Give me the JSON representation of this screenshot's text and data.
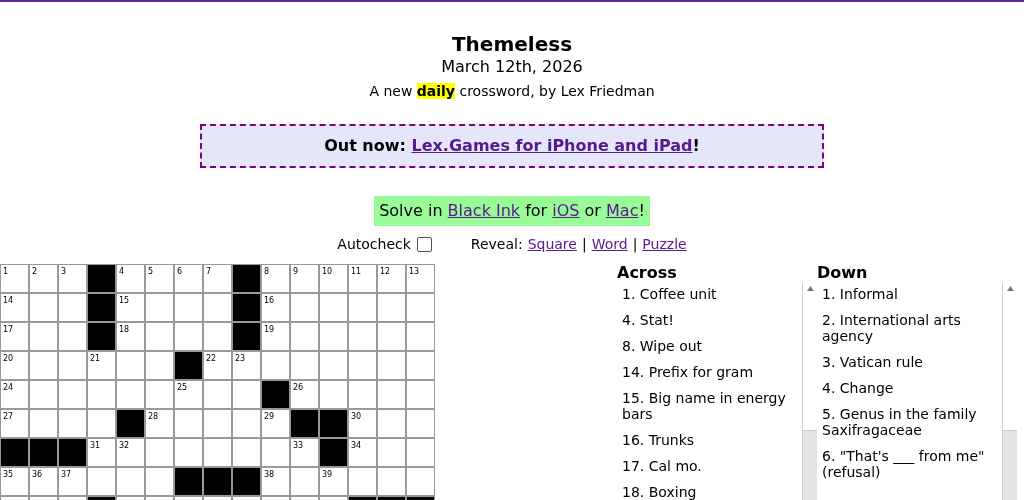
{
  "header": {
    "title": "Themeless",
    "date": "March 12th, 2026",
    "subtitle": "A new **daily** crossword, by Lex Friedman"
  },
  "banner": {
    "prefix": "Out now:",
    "link": "Lex.Games for iPhone and iPad",
    "suffix": "!"
  },
  "promo": {
    "parts": [
      {
        "kind": "text",
        "text": "Solve in "
      },
      {
        "kind": "link",
        "text": "Black Ink"
      },
      {
        "kind": "text",
        "text": " for "
      },
      {
        "kind": "link",
        "text": "iOS"
      },
      {
        "kind": "text",
        "text": " or "
      },
      {
        "kind": "link",
        "text": "Mac"
      },
      {
        "kind": "text",
        "text": "!"
      }
    ]
  },
  "controls": {
    "autocheck": {
      "label": "Autocheck",
      "checked": false
    },
    "reveal": {
      "label": "Reveal:",
      "items": [
        {
          "kind": "link",
          "text": "Square"
        },
        {
          "kind": "separator",
          "text": "|"
        },
        {
          "kind": "link",
          "text": "Word"
        },
        {
          "kind": "separator",
          "text": "|"
        },
        {
          "kind": "link",
          "text": "Puzzle"
        }
      ]
    }
  },
  "grid": {
    "rows": [
      {
        "cells": [
          {
            "number": "1",
            "black": false
          },
          {
            "number": "2",
            "black": false
          },
          {
            "number": "3",
            "black": false
          },
          {
            "black": true
          },
          {
            "number": "4",
            "black": false
          },
          {
            "number": "5",
            "black": false
          },
          {
            "number": "6",
            "black": false
          },
          {
            "number": "7",
            "black": false
          },
          {
            "black": true
          },
          {
            "number": "8",
            "black": false
          },
          {
            "number": "9",
            "black": false
          },
          {
            "number": "10",
            "black": false
          },
          {
            "number": "11",
            "black": false
          },
          {
            "number": "12",
            "black": false
          },
          {
            "number": "13",
            "black": false
          }
        ]
      },
      {
        "cells": [
          {
            "number": "14",
            "black": false
          },
          {
            "black": false
          },
          {
            "black": false
          },
          {
            "black": true
          },
          {
            "number": "15",
            "black": false
          },
          {
            "black": false
          },
          {
            "black": false
          },
          {
            "black": false
          },
          {
            "black": true
          },
          {
            "number": "16",
            "black": false
          },
          {
            "black": false
          },
          {
            "black": false
          },
          {
            "black": false
          },
          {
            "black": false
          },
          {
            "black": false
          }
        ]
      },
      {
        "cells": [
          {
            "number": "17",
            "black": false
          },
          {
            "black": false
          },
          {
            "black": false
          },
          {
            "black": true
          },
          {
            "number": "18",
            "black": false
          },
          {
            "black": false
          },
          {
            "black": false
          },
          {
            "black": false
          },
          {
            "black": true
          },
          {
            "number": "19",
            "black": false
          },
          {
            "black": false
          },
          {
            "black": false
          },
          {
            "black": false
          },
          {
            "black": false
          },
          {
            "black": false
          }
        ]
      },
      {
        "cells": [
          {
            "number": "20",
            "black": false
          },
          {
            "black": false
          },
          {
            "black": false
          },
          {
            "number": "21",
            "black": false
          },
          {
            "black": false
          },
          {
            "black": false
          },
          {
            "black": true
          },
          {
            "number": "22",
            "black": false
          },
          {
            "number": "23",
            "black": false
          },
          {
            "black": false
          },
          {
            "black": false
          },
          {
            "black": false
          },
          {
            "black": false
          },
          {
            "black": false
          },
          {
            "black": false
          }
        ]
      },
      {
        "cells": [
          {
            "number": "24",
            "black": false
          },
          {
            "black": false
          },
          {
            "black": false
          },
          {
            "black": false
          },
          {
            "black": false
          },
          {
            "black": false
          },
          {
            "number": "25",
            "black": false
          },
          {
            "black": false
          },
          {
            "black": false
          },
          {
            "black": true
          },
          {
            "number": "26",
            "black": false
          },
          {
            "black": false
          },
          {
            "black": false
          },
          {
            "black": false
          },
          {
            "black": false
          }
        ]
      },
      {
        "cells": [
          {
            "number": "27",
            "black": false
          },
          {
            "black": false
          },
          {
            "black": false
          },
          {
            "black": false
          },
          {
            "black": true
          },
          {
            "number": "28",
            "black": false
          },
          {
            "black": false
          },
          {
            "black": false
          },
          {
            "black": false
          },
          {
            "number": "29",
            "black": false
          },
          {
            "black": true
          },
          {
            "black": true
          },
          {
            "number": "30",
            "black": false
          },
          {
            "black": false
          },
          {
            "black": false
          }
        ]
      },
      {
        "cells": [
          {
            "black": true
          },
          {
            "black": true
          },
          {
            "black": true
          },
          {
            "number": "31",
            "black": false
          },
          {
            "number": "32",
            "black": false
          },
          {
            "black": false
          },
          {
            "black": false
          },
          {
            "black": false
          },
          {
            "black": false
          },
          {
            "black": false
          },
          {
            "number": "33",
            "black": false
          },
          {
            "black": true
          },
          {
            "number": "34",
            "black": false
          },
          {
            "black": false
          },
          {
            "black": false
          }
        ]
      },
      {
        "cells": [
          {
            "number": "35",
            "black": false
          },
          {
            "number": "36",
            "black": false
          },
          {
            "number": "37",
            "black": false
          },
          {
            "black": false
          },
          {
            "black": false
          },
          {
            "black": false
          },
          {
            "black": true
          },
          {
            "black": true
          },
          {
            "black": true
          },
          {
            "number": "38",
            "black": false
          },
          {
            "black": false
          },
          {
            "number": "39",
            "black": false
          },
          {
            "black": false
          },
          {
            "black": false
          },
          {
            "black": false
          }
        ]
      },
      {
        "cells": [
          {
            "black": false
          },
          {
            "black": false
          },
          {
            "black": false
          },
          {
            "black": true
          },
          {
            "black": false
          },
          {
            "black": false
          },
          {
            "black": false
          },
          {
            "black": false
          },
          {
            "black": false
          },
          {
            "black": false
          },
          {
            "black": false
          },
          {
            "black": false
          },
          {
            "black": true
          },
          {
            "black": true
          },
          {
            "black": true
          }
        ]
      }
    ]
  },
  "clues": [
    {
      "heading": "Across",
      "items": [
        "1. Coffee unit",
        "4. Stat!",
        "8. Wipe out",
        "14. Prefix for gram",
        "15. Big name in energy bars",
        "16. Trunks",
        "17. Cal mo.",
        "18. Boxing"
      ]
    },
    {
      "heading": "Down",
      "items": [
        "1. Informal",
        "2. International arts agency",
        "3. Vatican rule",
        "4. Change",
        "5. Genus in the family Saxifragaceae",
        "6. \"That's ___ from me\" (refusal)"
      ]
    }
  ]
}
